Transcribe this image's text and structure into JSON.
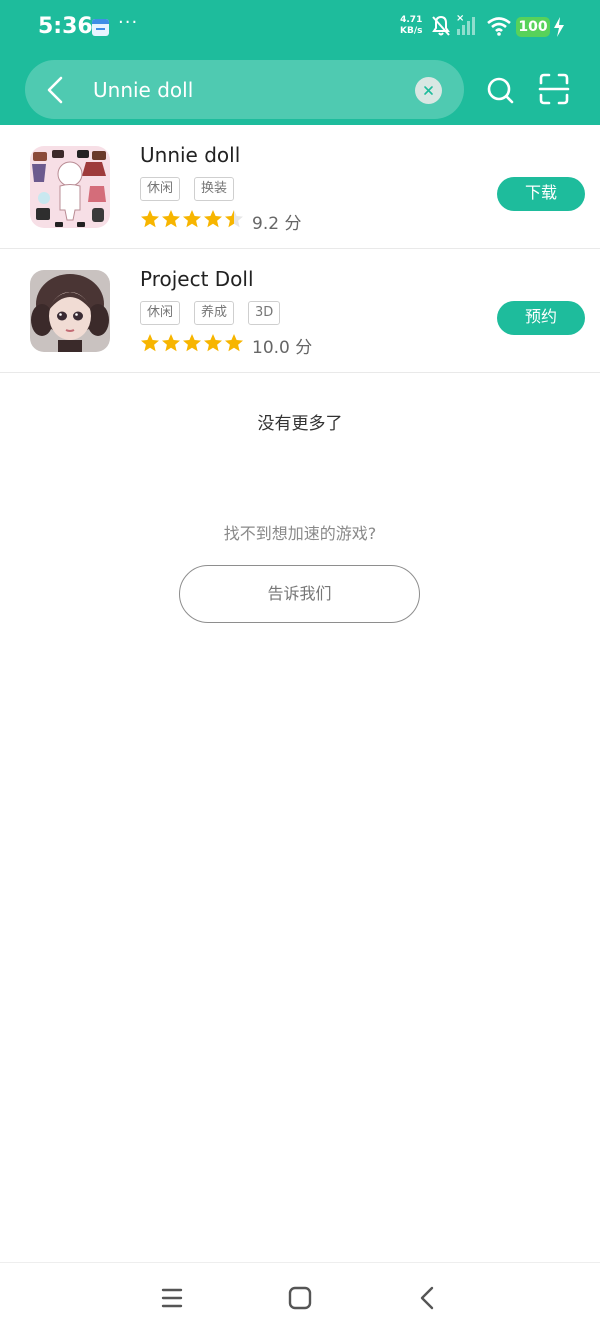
{
  "status_bar": {
    "time": "5:36",
    "more": "···",
    "net_speed_value": "4.71",
    "net_speed_unit": "KB/s",
    "battery": "100"
  },
  "search": {
    "query": "Unnie doll",
    "icons": [
      "back-arrow-icon",
      "clear-icon",
      "search-icon",
      "scan-icon"
    ]
  },
  "results": [
    {
      "name": "Unnie doll",
      "tags": [
        "休闲",
        "换装"
      ],
      "stars": 4.5,
      "rating": "9.2 分",
      "action": "下载"
    },
    {
      "name": "Project Doll",
      "tags": [
        "休闲",
        "养成",
        "3D"
      ],
      "stars": 5,
      "rating": "10.0 分",
      "action": "预约"
    }
  ],
  "no_more": "没有更多了",
  "not_found_prompt": "找不到想加速的游戏?",
  "tell_us": "告诉我们",
  "colors": {
    "accent": "#1ebc9c",
    "star": "#f7b500"
  }
}
